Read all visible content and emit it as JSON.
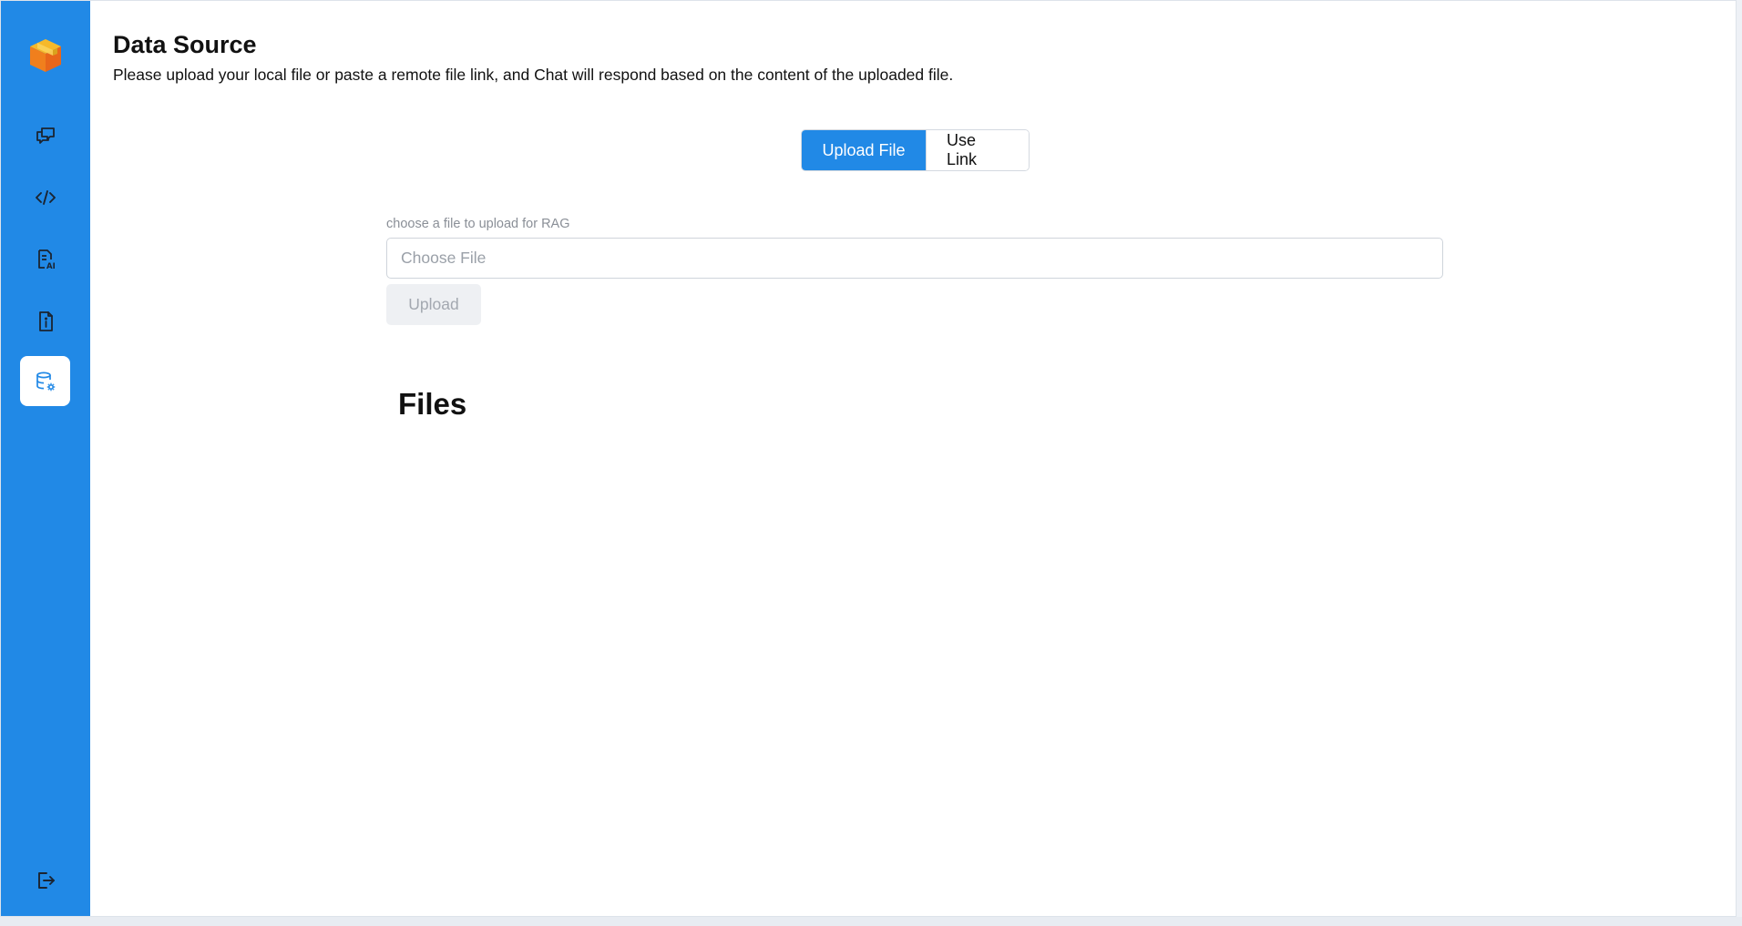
{
  "header": {
    "title": "Data Source",
    "description": "Please upload your local file or paste a remote file link, and Chat will respond based on the content of the uploaded file."
  },
  "sidebar": {
    "items": [
      {
        "icon": "chat-bubbles-icon",
        "active": false
      },
      {
        "icon": "code-icon",
        "active": false
      },
      {
        "icon": "ai-document-icon",
        "active": false
      },
      {
        "icon": "document-info-icon",
        "active": false
      },
      {
        "icon": "database-settings-icon",
        "active": true
      }
    ],
    "logout_icon": "logout-icon"
  },
  "mode_tabs": {
    "upload_file": "Upload File",
    "use_link": "Use Link",
    "selected": "upload_file"
  },
  "upload": {
    "label": "choose a file to upload for RAG",
    "placeholder": "Choose File",
    "button": "Upload"
  },
  "files": {
    "title": "Files"
  },
  "colors": {
    "accent": "#2189e6",
    "logo_orange": "#f07f1d",
    "logo_yellow": "#f6b92a"
  }
}
